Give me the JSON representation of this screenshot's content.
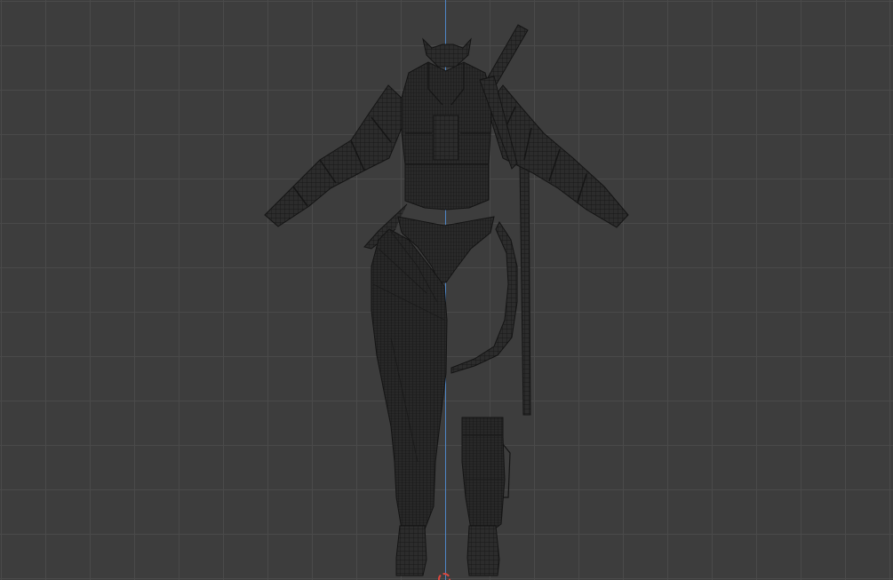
{
  "viewport": {
    "view": "front-orthographic",
    "background_color": "#3d3d3d",
    "grid_color": "#4a4a4a",
    "axis_color": "#4f86c6",
    "mesh_fill_color": "#2c2c2c",
    "mesh_wire_color": "#111111"
  },
  "objects": [
    "mask-mesh",
    "jacket-mesh",
    "left-sleeve-mesh",
    "right-sleeve-mesh",
    "bikini-bottom-mesh",
    "leg-mesh",
    "boot-mesh",
    "sword-mesh",
    "sword-strap-mesh"
  ],
  "icons": {
    "origin": "3d-cursor-icon"
  }
}
